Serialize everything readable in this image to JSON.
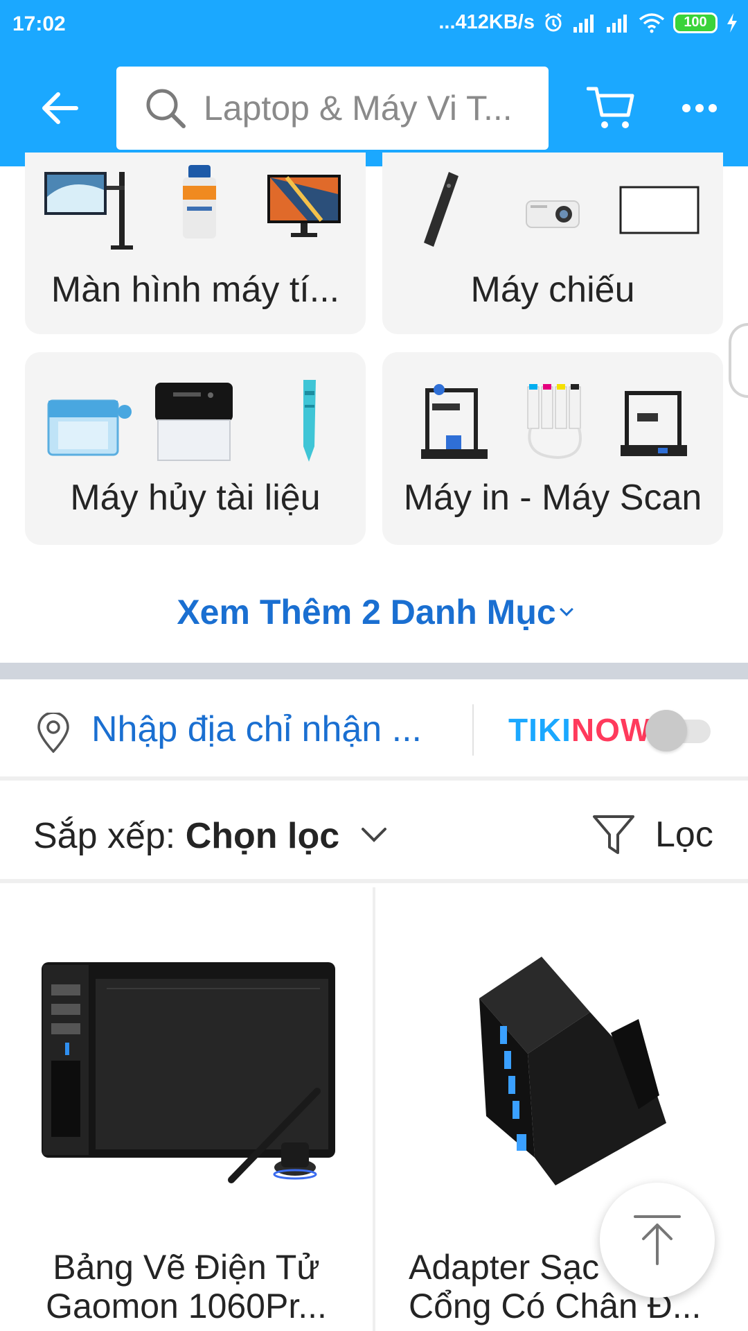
{
  "status_bar": {
    "time": "17:02",
    "speed": "...412KB/s",
    "battery": "100"
  },
  "header": {
    "search_text": "Laptop & Máy Vi T...",
    "back_icon": "arrow-left-icon",
    "cart_icon": "cart-icon",
    "more_icon": "more-horizontal-icon"
  },
  "categories": [
    {
      "label": "Màn hình máy tí..."
    },
    {
      "label": "Máy chiếu"
    },
    {
      "label": "Máy hủy tài liệu"
    },
    {
      "label": "Máy in - Máy Scan"
    }
  ],
  "more_categories": "Xem Thêm 2 Danh Mục",
  "address": {
    "placeholder": "Nhập địa chỉ nhận ...",
    "tiki": "TIKI",
    "now": "NOW",
    "toggle_on": false
  },
  "sort": {
    "prefix": "Sắp xếp: ",
    "value": "Chọn lọc",
    "filter_label": "Lọc"
  },
  "products": [
    {
      "line1": "Bảng Vẽ Điện Tử",
      "line2": "Gaomon 1060Pr..."
    },
    {
      "line1": "Adapter Sạc",
      "line2": "Cổng Có Chân Đ..."
    }
  ],
  "colors": {
    "header_blue": "#1ba8ff",
    "link_blue": "#1a6fd1",
    "tikinow_red": "#ff3a5c"
  }
}
